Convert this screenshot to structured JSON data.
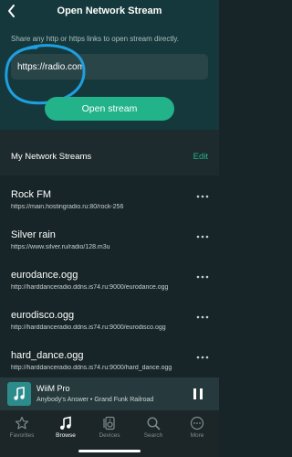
{
  "header": {
    "title": "Open Network Stream"
  },
  "stream_form": {
    "hint": "Share any http or https links to open stream directly.",
    "url_value": "https://radio.com",
    "open_button_label": "Open stream"
  },
  "my_streams": {
    "title": "My Network Streams",
    "edit_label": "Edit",
    "items": [
      {
        "name": "Rock FM",
        "url": "https://main.hostingradio.ru:80/rock-256"
      },
      {
        "name": "Silver rain",
        "url": "https://www.silver.ru/radio/128.m3u"
      },
      {
        "name": "eurodance.ogg",
        "url": "http://harddanceradio.ddns.is74.ru:9000/eurodance.ogg"
      },
      {
        "name": "eurodisco.ogg",
        "url": "http://harddanceradio.ddns.is74.ru:9000/eurodisco.ogg"
      },
      {
        "name": "hard_dance.ogg",
        "url": "http://harddanceradio.ddns.is74.ru:9000/hard_dance.ogg"
      }
    ]
  },
  "now_playing": {
    "title": "WiiM Pro",
    "subtitle": "Anybody's Answer • Grand Funk Railroad"
  },
  "tab_bar": {
    "items": [
      {
        "label": "Favorites",
        "icon": "star-icon",
        "active": false
      },
      {
        "label": "Browse",
        "icon": "music-note-icon",
        "active": true
      },
      {
        "label": "Devices",
        "icon": "speaker-icon",
        "active": false
      },
      {
        "label": "Search",
        "icon": "search-icon",
        "active": false
      },
      {
        "label": "More",
        "icon": "more-icon",
        "active": false
      }
    ]
  },
  "colors": {
    "accent": "#22b38a",
    "header_bg": "#15383c",
    "list_bg": "#182528",
    "annotation": "#1e9fe0"
  }
}
